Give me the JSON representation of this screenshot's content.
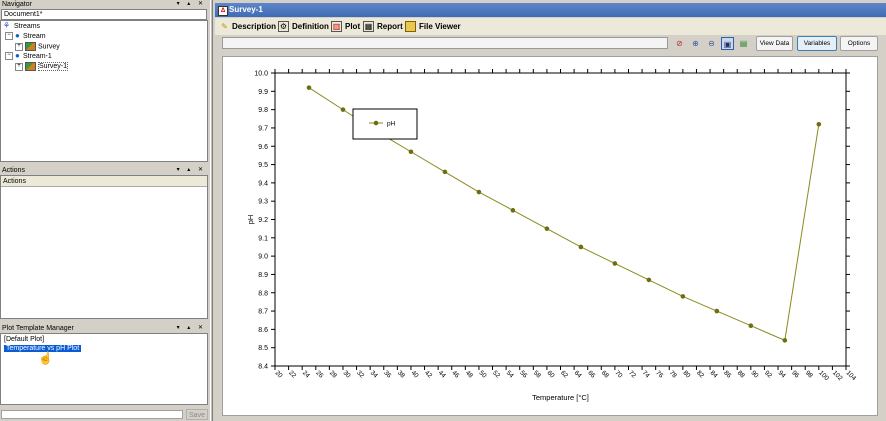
{
  "navigator": {
    "title": "Navigator",
    "document_tab": "Document1*",
    "tree": {
      "streams": "Streams",
      "stream": "Stream",
      "survey": "Survey",
      "stream1": "Stream-1",
      "survey1": "Survey-1"
    }
  },
  "actions": {
    "title": "Actions",
    "header": "Actions"
  },
  "plot_template_manager": {
    "title": "Plot Template Manager",
    "items": [
      "[Default Plot]",
      "Temperature vs pH Plot"
    ],
    "save_label": "Save"
  },
  "window": {
    "title": "Survey-1"
  },
  "toolbar": {
    "description": "Description",
    "definition": "Definition",
    "plot": "Plot",
    "report": "Report",
    "file_viewer": "File Viewer"
  },
  "plot_buttons": {
    "view_data": "View Data",
    "variables": "Variables",
    "options": "Options"
  },
  "icons": {
    "pane_controls": "pin-maximize-close-icons",
    "zoom_reset": "zoom-reset-icon",
    "zoom_in": "zoom-in-icon",
    "zoom_out": "zoom-out-icon",
    "image": "image-icon",
    "export": "export-icon"
  },
  "chart_data": {
    "type": "line",
    "xlabel": "Temperature [°C]",
    "ylabel": "pH",
    "xlim": [
      20,
      104
    ],
    "ylim": [
      8.4,
      10.0
    ],
    "x_ticks": [
      20,
      22,
      24,
      26,
      28,
      30,
      32,
      34,
      36,
      38,
      40,
      42,
      44,
      46,
      48,
      50,
      52,
      54,
      56,
      58,
      60,
      62,
      64,
      66,
      68,
      70,
      72,
      74,
      76,
      78,
      80,
      82,
      84,
      86,
      88,
      90,
      92,
      94,
      96,
      98,
      100,
      102,
      104
    ],
    "y_ticks": [
      "8.4",
      "8.5",
      "8.6",
      "8.7",
      "8.8",
      "8.9",
      "9.0",
      "9.1",
      "9.2",
      "9.3",
      "9.4",
      "9.5",
      "9.6",
      "9.7",
      "9.8",
      "9.9",
      "10.0"
    ],
    "grid": false,
    "legend_position": "top-left",
    "series": [
      {
        "name": "pH",
        "color": "#8a8a1e",
        "x": [
          25,
          30,
          35,
          40,
          45,
          50,
          55,
          60,
          65,
          70,
          75,
          80,
          85,
          90,
          95,
          100
        ],
        "y": [
          9.92,
          9.8,
          9.68,
          9.57,
          9.46,
          9.35,
          9.25,
          9.15,
          9.05,
          8.96,
          8.87,
          8.78,
          8.7,
          8.62,
          8.54,
          9.72
        ]
      }
    ]
  }
}
